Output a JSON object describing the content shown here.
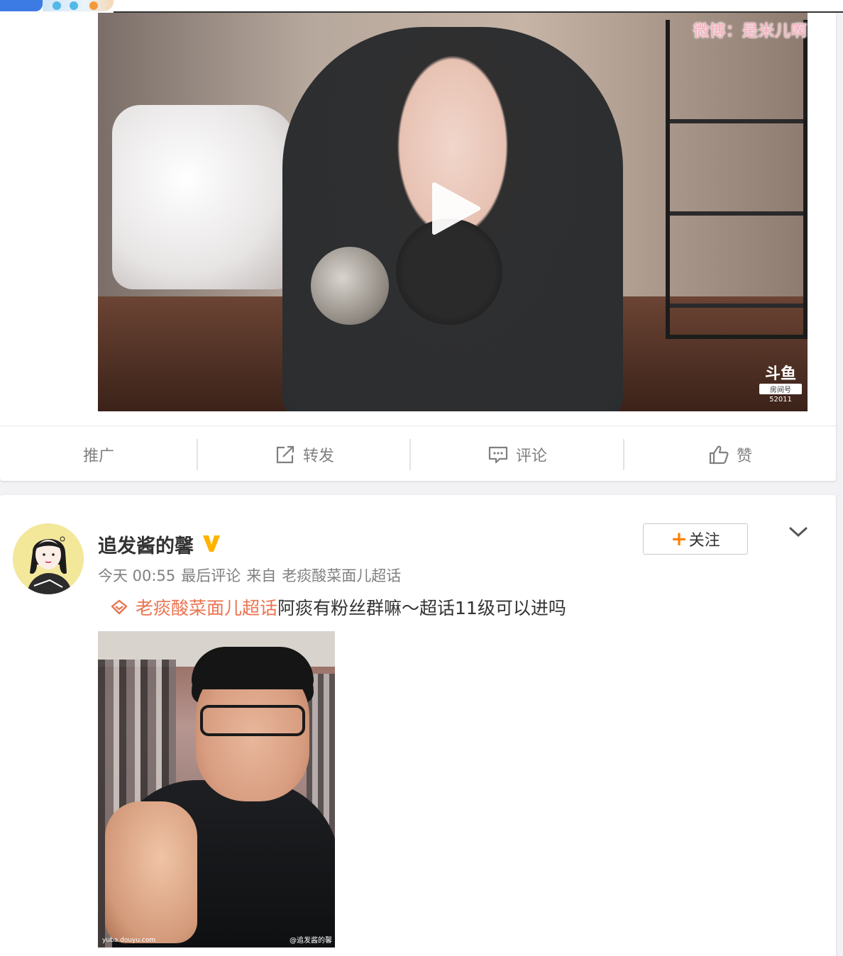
{
  "video": {
    "watermark_top": "微博：是米儿啊",
    "watermark_logo": "斗鱼",
    "room_label": "房间号",
    "room_number": "52011"
  },
  "actions": {
    "promote": "推广",
    "repost": "转发",
    "comment": "评论",
    "like": "赞"
  },
  "post": {
    "username": "追发酱的馨",
    "time": "今天 00:55",
    "last_comment": "最后评论",
    "source_prefix": "来自",
    "source": "老痰酸菜面儿超话",
    "follow_label": "关注",
    "topic": "老痰酸菜面儿超话",
    "text": "阿痰有粉丝群嘛～超话11级可以进吗",
    "photo_watermark_right": "@追发酱的馨",
    "photo_watermark_left": "yuba.douyu.com"
  },
  "colors": {
    "accent": "#ff8200",
    "topic": "#eb7350",
    "muted": "#808080"
  }
}
